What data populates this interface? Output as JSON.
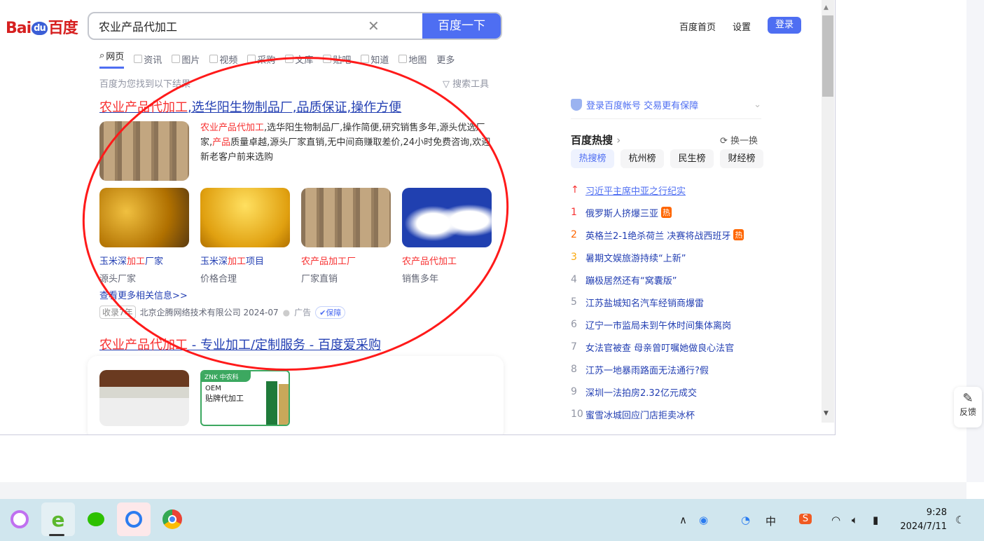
{
  "header": {
    "logo": "Bai du 百度",
    "query": "农业产品代加工",
    "search_button": "百度一下",
    "links": [
      "百度首页",
      "设置"
    ],
    "login": "登录"
  },
  "tabs": [
    "网页",
    "资讯",
    "图片",
    "视频",
    "采购",
    "文库",
    "贴吧",
    "知道",
    "地图",
    "更多"
  ],
  "found": "百度为您找到以下结果",
  "tools": "搜索工具",
  "result1": {
    "title_red": "农业产品代加工",
    "title_rest": ",选华阳生物制品厂,品质保证,操作方便",
    "desc": [
      {
        "t": "农业产品代加工",
        "red": true
      },
      {
        "t": ",选华阳生物制品厂,操作简便,研究销售多年,源头优选厂家,"
      },
      {
        "t": "产品",
        "red": true
      },
      {
        "t": "质量卓越,源头厂家直销,无中间商赚取差价,24小时免费咨询,欢迎新老客户前来选购"
      }
    ],
    "cards": [
      {
        "a": "玉米深",
        "b": "加工",
        "c": "厂家",
        "sub": "源头厂家",
        "img": "corn"
      },
      {
        "a": "玉米深",
        "b": "加工",
        "c": "项目",
        "sub": "价格合理",
        "img": "cornmeal"
      },
      {
        "a": "",
        "b": "农产品加工",
        "c": "厂",
        "sub": "厂家直销",
        "img": "drums"
      },
      {
        "a": "",
        "b": "农产品代加工",
        "c": "",
        "sub": "销售多年",
        "img": "powder"
      }
    ],
    "more": "查看更多相关信息>>",
    "tag": "收录7年",
    "company": "北京企腾网络技术有限公司 2024-07",
    "ad": "广告",
    "guarantee": "保障"
  },
  "result2": {
    "title_red": "农业产品代加工",
    "title_rest": " - 专业加工/定制服务 - 百度爱采购",
    "oem_brand": "ZNK 中农科",
    "oem_line1": "OEM",
    "oem_line2": "贴牌代加工"
  },
  "sidebar": {
    "login_tip": "登录百度帐号 交易更有保障",
    "hot_title": "百度热搜",
    "refresh": "换一换",
    "hot_tabs": [
      "热搜榜",
      "杭州榜",
      "民生榜",
      "财经榜"
    ],
    "top": "习近平主席中亚之行纪实",
    "items": [
      {
        "n": "1",
        "t": "俄罗斯人挤爆三亚",
        "hot": "热",
        "c": "#f73131"
      },
      {
        "n": "2",
        "t": "英格兰2-1绝杀荷兰 决赛将战西班牙",
        "hot": "热",
        "c": "#ff6600"
      },
      {
        "n": "3",
        "t": "暑期文娱旅游持续“上新”",
        "c": "#faa90e"
      },
      {
        "n": "4",
        "t": "蹦极居然还有“窝囊版”"
      },
      {
        "n": "5",
        "t": "江苏盐城知名汽车经销商爆雷"
      },
      {
        "n": "6",
        "t": "辽宁一市监局未到午休时间集体离岗"
      },
      {
        "n": "7",
        "t": "女法官被查 母亲曾叮嘱她做良心法官"
      },
      {
        "n": "8",
        "t": "江苏一地暴雨路面无法通行?假"
      },
      {
        "n": "9",
        "t": "深圳一法拍房2.32亿元成交"
      },
      {
        "n": "10",
        "t": "蜜雪冰城回应门店拒卖冰杯"
      }
    ]
  },
  "feedback": "反馈",
  "taskbar": {
    "time": "9:28",
    "date": "2024/7/11",
    "ime": "中"
  },
  "colors": {
    "accent": "#4e6ef2",
    "link": "#2440b3",
    "red": "#f73131",
    "annotation": "#ff1a1a"
  }
}
